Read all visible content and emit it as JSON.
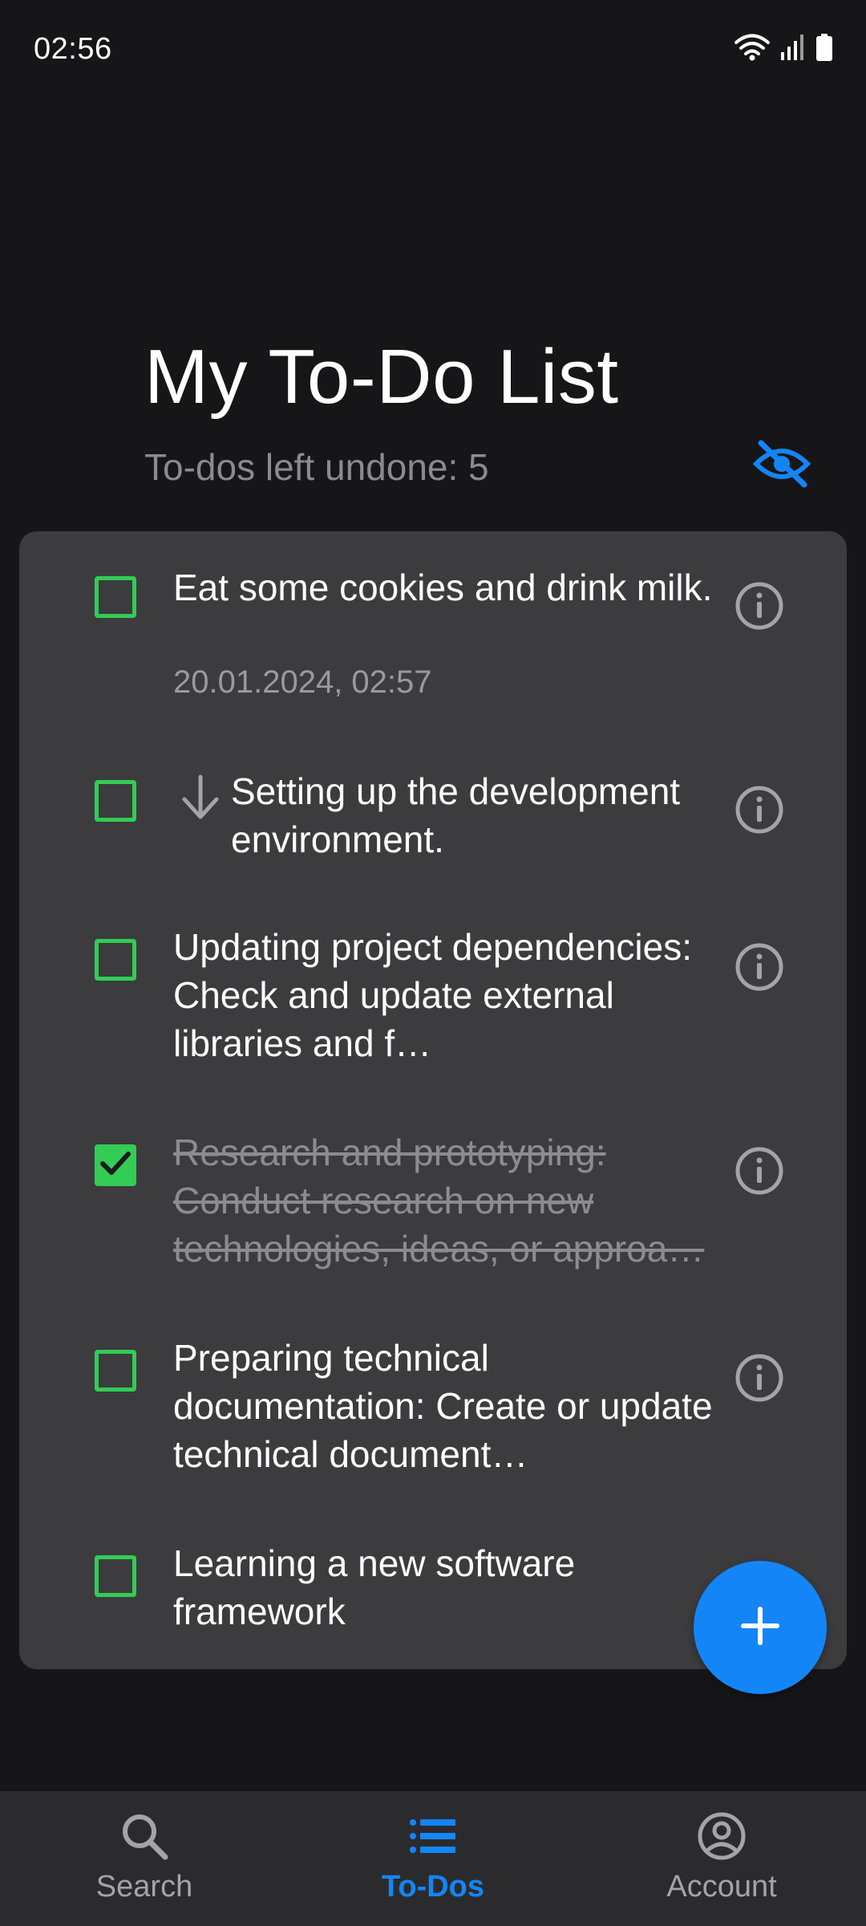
{
  "status_bar": {
    "time": "02:56"
  },
  "header": {
    "title": "My To-Do List",
    "subtitle": "To-dos left undone: 5",
    "visibility_icon": "eye-off-icon"
  },
  "todos": [
    {
      "text": "Eat some cookies and drink milk.",
      "date": "20.01.2024, 02:57",
      "checked": false
    },
    {
      "text": "Setting up the development environment.",
      "checked": false,
      "subtask_icon": "arrow-down-icon"
    },
    {
      "text": "Updating project dependencies: Check and update external libraries and f…",
      "checked": false
    },
    {
      "text": "Research and prototyping: Conduct research on new technologies, ideas, or approa…",
      "checked": true
    },
    {
      "text": "Preparing technical documentation: Create or update technical document…",
      "checked": false
    },
    {
      "text": "Learning a new software framework",
      "checked": false
    }
  ],
  "fab": {
    "icon": "plus-icon"
  },
  "bottom_nav": {
    "items": [
      {
        "label": "Search",
        "icon": "search-icon",
        "active": false
      },
      {
        "label": "To-Dos",
        "icon": "list-icon",
        "active": true
      },
      {
        "label": "Account",
        "icon": "account-icon",
        "active": false
      }
    ]
  },
  "colors": {
    "background": "#161618",
    "card": "#3c3c3f",
    "accent": "#1485f7",
    "checkbox": "#33cc55",
    "muted_text": "#8a8a8f"
  }
}
